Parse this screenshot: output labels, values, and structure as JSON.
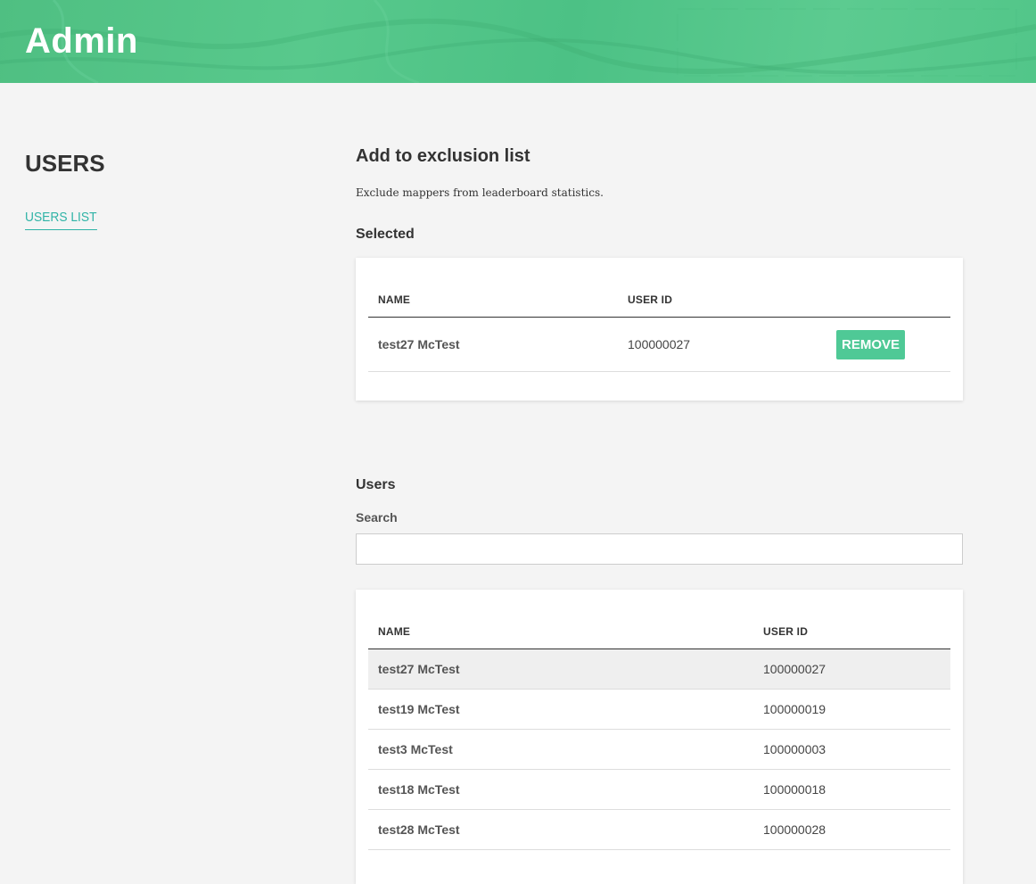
{
  "header": {
    "title": "Admin"
  },
  "sidebar": {
    "section_title": "USERS",
    "nav_items": [
      {
        "label": "USERS LIST",
        "active": true
      }
    ]
  },
  "exclusion": {
    "title": "Add to exclusion list",
    "description": "Exclude mappers from leaderboard statistics.",
    "selected_title": "Selected",
    "columns": [
      "NAME",
      "USER ID"
    ],
    "rows": [
      {
        "name": "test27 McTest",
        "user_id": "100000027",
        "action": "REMOVE"
      }
    ]
  },
  "users": {
    "title": "Users",
    "search_label": "Search",
    "search_value": "",
    "columns": [
      "NAME",
      "USER ID"
    ],
    "rows": [
      {
        "name": "test27 McTest",
        "user_id": "100000027",
        "highlighted": true
      },
      {
        "name": "test19 McTest",
        "user_id": "100000019"
      },
      {
        "name": "test3 McTest",
        "user_id": "100000003"
      },
      {
        "name": "test18 McTest",
        "user_id": "100000018"
      },
      {
        "name": "test28 McTest",
        "user_id": "100000028"
      }
    ]
  },
  "colors": {
    "accent": "#4fc996",
    "link": "#2fb3a6",
    "header_green": "#52c689"
  }
}
